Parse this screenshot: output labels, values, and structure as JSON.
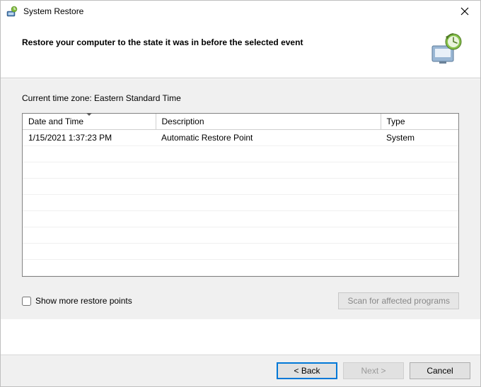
{
  "window": {
    "title": "System Restore"
  },
  "header": {
    "heading": "Restore your computer to the state it was in before the selected event"
  },
  "body": {
    "timezone_label": "Current time zone: Eastern Standard Time",
    "columns": {
      "datetime": "Date and Time",
      "description": "Description",
      "type": "Type"
    },
    "rows": [
      {
        "datetime": "1/15/2021 1:37:23 PM",
        "description": "Automatic Restore Point",
        "type": "System"
      }
    ],
    "show_more_label": "Show more restore points",
    "scan_label": "Scan for affected programs"
  },
  "footer": {
    "back": "< Back",
    "next": "Next >",
    "cancel": "Cancel"
  }
}
